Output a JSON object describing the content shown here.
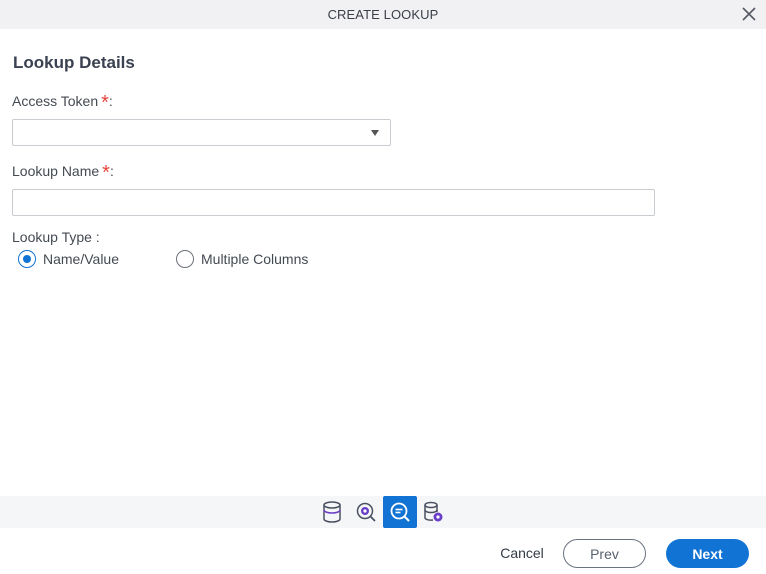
{
  "dialog": {
    "title": "CREATE LOOKUP",
    "close_icon": "close-icon"
  },
  "section": {
    "title": "Lookup Details"
  },
  "fields": {
    "access_token": {
      "label": "Access Token",
      "required_mark": "*",
      "colon": ":",
      "value": ""
    },
    "lookup_name": {
      "label": "Lookup Name",
      "required_mark": "*",
      "colon": ":",
      "value": "",
      "placeholder": ""
    },
    "lookup_type": {
      "label": "Lookup Type :",
      "options": [
        {
          "label": "Name/Value",
          "checked": true
        },
        {
          "label": "Multiple Columns",
          "checked": false
        }
      ]
    }
  },
  "toolbar": {
    "tools": [
      {
        "icon": "database-icon",
        "active": false
      },
      {
        "icon": "search-settings-icon",
        "active": false
      },
      {
        "icon": "search-list-icon",
        "active": true
      },
      {
        "icon": "database-settings-icon",
        "active": false
      }
    ]
  },
  "footer": {
    "cancel_label": "Cancel",
    "prev_label": "Prev",
    "next_label": "Next"
  },
  "colors": {
    "accent": "#1173d4",
    "required": "#e8453c",
    "icon_purple": "#6a3fc8"
  }
}
